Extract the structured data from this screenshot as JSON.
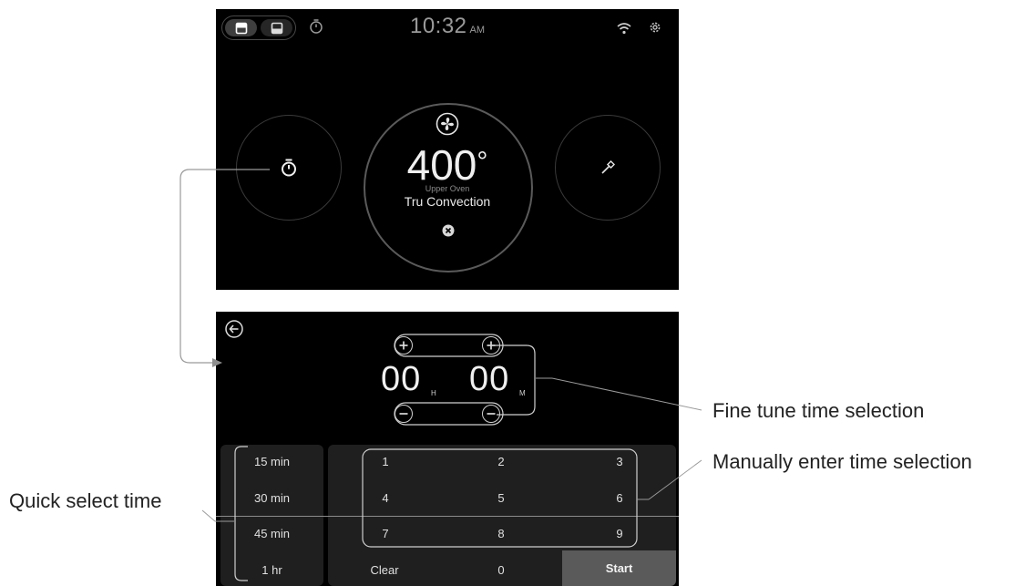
{
  "top_screen": {
    "clock": {
      "time": "10:32",
      "ampm": "AM"
    },
    "icons": {
      "upper_oven_toggle": "upper-oven-icon",
      "lower_oven_toggle": "lower-oven-icon",
      "timer": "timer-icon",
      "wifi": "wifi-icon",
      "settings": "gear-icon",
      "fan": "fan-icon",
      "probe": "probe-icon",
      "cancel": "close-icon"
    },
    "oven": {
      "temperature": "400",
      "degree_symbol": "°",
      "oven_name": "Upper Oven",
      "mode": "Tru Convection"
    }
  },
  "bottom_screen": {
    "hours": "00",
    "hours_unit": "H",
    "minutes": "00",
    "minutes_unit": "M",
    "quick_select": [
      "15 min",
      "30 min",
      "45 min",
      "1 hr"
    ],
    "keypad": [
      "1",
      "2",
      "3",
      "4",
      "5",
      "6",
      "7",
      "8",
      "9"
    ],
    "clear_label": "Clear",
    "zero_label": "0",
    "start_label": "Start"
  },
  "callouts": {
    "fine_tune": "Fine tune time selection",
    "manual_entry": "Manually enter time selection",
    "quick_select": "Quick select time"
  },
  "colors": {
    "screen_bg": "#000000",
    "panel_bg": "#1f1f1f",
    "start_bg": "#5a5a5a",
    "annotation_line": "#9a9a9a"
  }
}
